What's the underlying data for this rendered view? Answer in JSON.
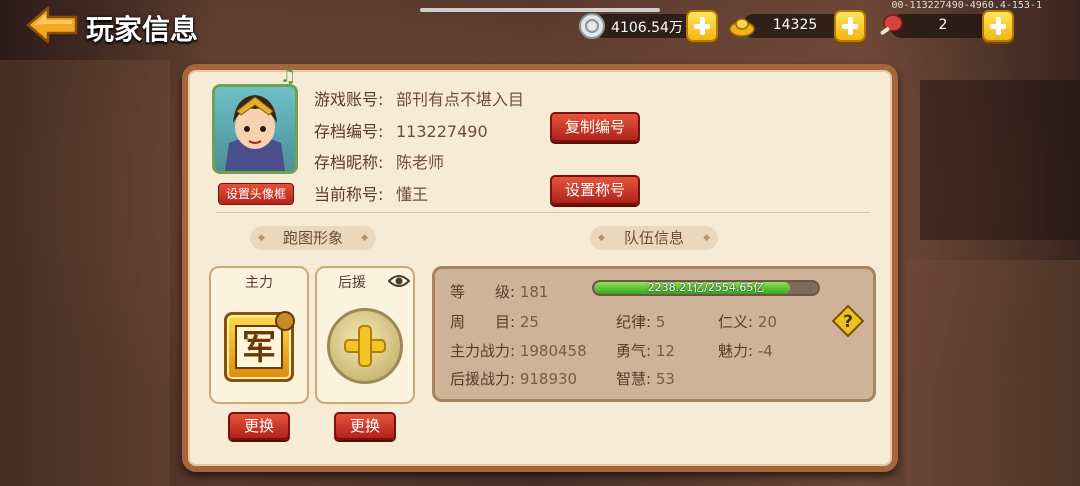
{
  "header": {
    "title": "玩家信息",
    "debug_id": "00-113227490-4960.4-153-1"
  },
  "resources": {
    "silver": {
      "value": "4106.54万",
      "icon": "silver-coin-icon"
    },
    "gold": {
      "value": "14325",
      "icon": "gold-ingot-icon"
    },
    "meat": {
      "value": "2",
      "icon": "meat-icon"
    }
  },
  "profile": {
    "account_label": "游戏账号:",
    "account_value": "部刊有点不堪入目",
    "save_id_label": "存档编号:",
    "save_id_value": "113227490",
    "nickname_label": "存档昵称:",
    "nickname_value": "陈老师",
    "title_label": "当前称号:",
    "title_value": "懂王",
    "copy_id_button": "复制编号",
    "set_title_button": "设置称号",
    "set_frame_button": "设置头像框"
  },
  "run_image": {
    "section_title": "跑图形象",
    "main_label": "主力",
    "main_badge": "军",
    "support_label": "后援",
    "swap_button": "更换"
  },
  "team": {
    "section_title": "队伍信息",
    "level_label": "等　　级:",
    "level_value": "181",
    "exp_text": "2238.21亿/2554.65亿",
    "exp_fraction": 0.876,
    "cycle_label": "周　　目:",
    "cycle_value": "25",
    "discipline_label": "纪律:",
    "discipline_value": "5",
    "benevolence_label": "仁义:",
    "benevolence_value": "20",
    "main_power_label": "主力战力:",
    "main_power_value": "1980458",
    "courage_label": "勇气:",
    "courage_value": "12",
    "charm_label": "魅力:",
    "charm_value": "-4",
    "support_power_label": "后援战力:",
    "support_power_value": "918930",
    "wisdom_label": "智慧:",
    "wisdom_value": "53"
  }
}
